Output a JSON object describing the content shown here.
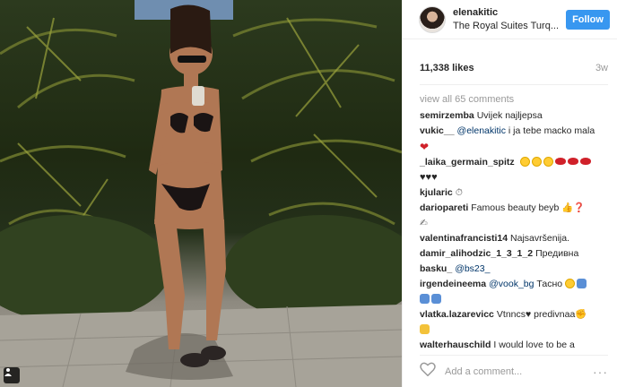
{
  "post": {
    "username": "elenakitic",
    "location": "The Royal Suites Turq...",
    "follow_label": "Follow",
    "likes": "11,338 likes",
    "age": "3w",
    "view_all": "view all 65 comments",
    "add_comment_placeholder": "Add a comment...",
    "more_glyph": "···"
  },
  "comments": [
    {
      "user": "semirzemba",
      "text": "Uvijek najljepsa",
      "mention": "",
      "emoji": []
    },
    {
      "user": "vukic__",
      "mention": "@elenakitic",
      "text": "i ja tebe macko mala",
      "emoji": [
        "red-heart-icon"
      ]
    },
    {
      "user": "_laika_germain_spitz",
      "text": "",
      "mention": "",
      "emoji": [
        "heart-eyes-face-icon",
        "heart-eyes-face-icon",
        "heart-eyes-face-icon",
        "kiss-lips-icon",
        "kiss-lips-icon",
        "kiss-lips-icon",
        "black-heart-icon",
        "black-heart-icon",
        "black-heart-icon"
      ]
    },
    {
      "user": "kjularic",
      "text": "",
      "mention": "",
      "emoji": [
        "stopwatch-icon"
      ]
    },
    {
      "user": "dariopareti",
      "text": "Famous beauty beyb",
      "mention": "",
      "emoji": [
        "thumbs-up-icon",
        "question-mark-icon",
        "hand-writing-icon"
      ]
    },
    {
      "user": "valentinafrancisti14",
      "text": "Najsavršenija.",
      "mention": "",
      "emoji": []
    },
    {
      "user": "damir_alihodzic_1_3_1_2",
      "text": "Предивна",
      "mention": "",
      "emoji": []
    },
    {
      "user": "basku_",
      "mention": "@bs23_",
      "text": "",
      "emoji": []
    },
    {
      "user": "irgendeineema",
      "mention": "@vook_bg",
      "text": "Тасно",
      "emoji": [
        "sad-face-icon",
        "person-icon",
        "person-icon",
        "person-icon"
      ]
    },
    {
      "user": "vlatka.lazarevicc",
      "text": "Vtnncs",
      "text2": "predivnaa",
      "mention": "",
      "emoji": [
        "black-heart-icon",
        "flexed-arm-icon",
        "person-yellow-icon"
      ]
    },
    {
      "user": "walterhauschild",
      "text": "I would love to be a",
      "mention": "",
      "emoji": []
    }
  ],
  "colors": {
    "accent": "#3897f0",
    "meta": "#999999",
    "mention": "#003569"
  }
}
